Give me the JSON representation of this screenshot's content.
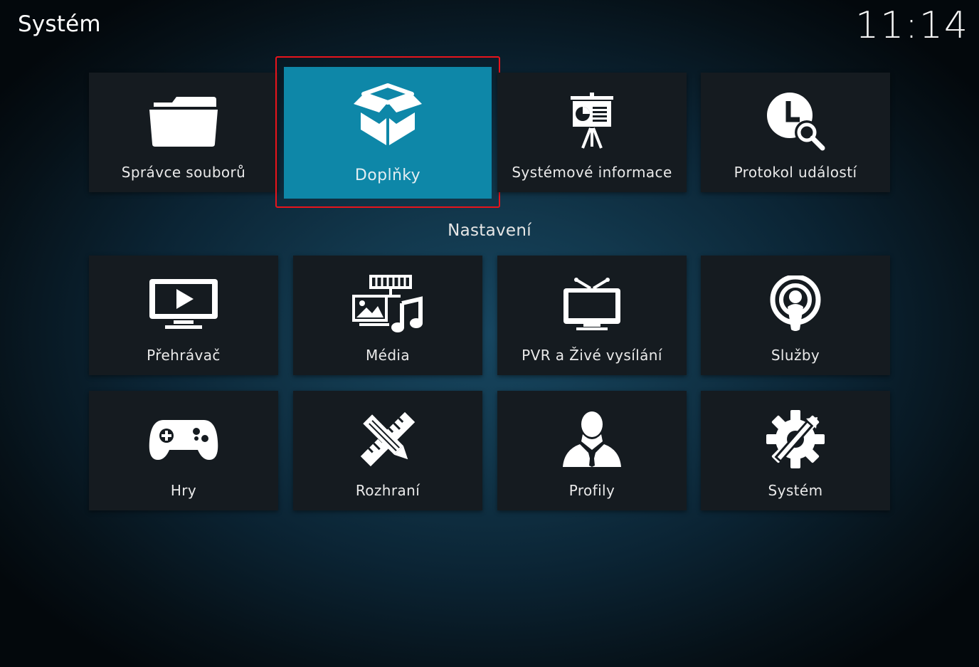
{
  "header": {
    "title": "Systém",
    "clock": "11:14"
  },
  "top_row": [
    {
      "label": "Správce souborů",
      "icon": "folder-icon"
    },
    {
      "label": "Doplňky",
      "icon": "box-icon",
      "focused": true
    },
    {
      "label": "Systémové informace",
      "icon": "presentation-board-icon"
    },
    {
      "label": "Protokol událostí",
      "icon": "clock-search-icon"
    }
  ],
  "settings_section": {
    "title": "Nastavení",
    "items": [
      {
        "label": "Přehrávač",
        "icon": "monitor-play-icon"
      },
      {
        "label": "Média",
        "icon": "media-icon"
      },
      {
        "label": "PVR a Živé vysílání",
        "icon": "tv-antenna-icon"
      },
      {
        "label": "Služby",
        "icon": "podcast-icon"
      },
      {
        "label": "Hry",
        "icon": "gamepad-icon"
      },
      {
        "label": "Rozhraní",
        "icon": "pencil-ruler-icon"
      },
      {
        "label": "Profily",
        "icon": "user-icon"
      },
      {
        "label": "Systém",
        "icon": "gear-tools-icon"
      }
    ]
  },
  "colors": {
    "focus_tile": "#0e87a8",
    "focus_outline": "#e8141c",
    "tile_background": "#151b20"
  }
}
